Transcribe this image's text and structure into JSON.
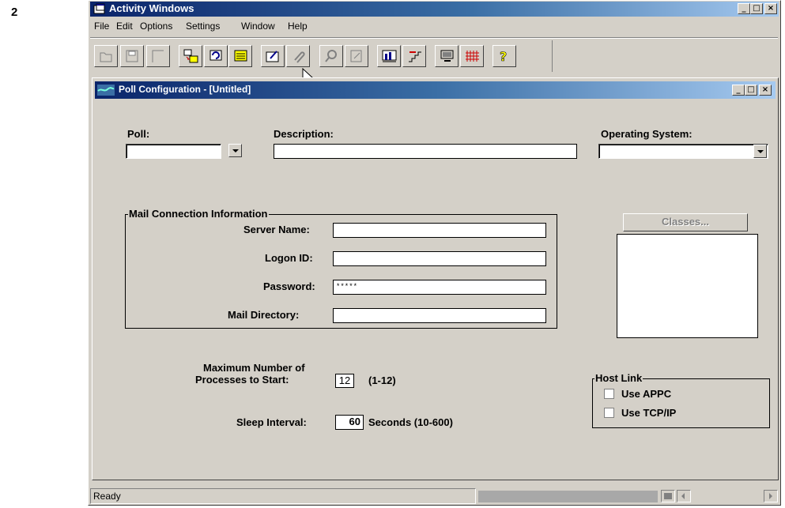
{
  "page_number": "2",
  "app": {
    "title": "Activity Windows",
    "menu": [
      "File",
      "Edit",
      "Options",
      "Settings",
      "Window",
      "Help"
    ],
    "toolbar_icons": [
      "open-icon",
      "save-icon",
      "blank-icon",
      "transfer-icon",
      "refresh-icon",
      "list-icon",
      "edit-icon",
      "attach-icon",
      "search-icon",
      "document-icon",
      "chart-icon",
      "stairs-icon",
      "monitor-icon",
      "grid-icon",
      "help-icon"
    ]
  },
  "child": {
    "title": "Poll Configuration - [Untitled]"
  },
  "form": {
    "poll_label": "Poll:",
    "poll_value": "",
    "description_label": "Description:",
    "description_value": "",
    "os_label": "Operating System:",
    "os_value": "",
    "mail_group_title": "Mail Connection Information",
    "server_name_label": "Server Name:",
    "server_name_value": "",
    "logon_id_label": "Logon ID:",
    "logon_id_value": "",
    "password_label": "Password:",
    "password_value": "*****",
    "mail_directory_label": "Mail Directory:",
    "mail_directory_value": "",
    "classes_button": "Classes...",
    "max_processes_label_1": "Maximum Number of",
    "max_processes_label_2": "Processes to Start:",
    "max_processes_value": "12",
    "max_processes_range": "(1-12)",
    "sleep_label": "Sleep Interval:",
    "sleep_value": "60",
    "sleep_units": "Seconds (10-600)",
    "host_link_title": "Host Link",
    "use_appc_label": "Use APPC",
    "use_appc_checked": false,
    "use_tcpip_label": "Use TCP/IP",
    "use_tcpip_checked": false
  },
  "status": {
    "text": "Ready"
  },
  "colors": {
    "title_active": "#0a246a",
    "title_gradient_end": "#a6caf0",
    "face": "#d4d0c8"
  }
}
